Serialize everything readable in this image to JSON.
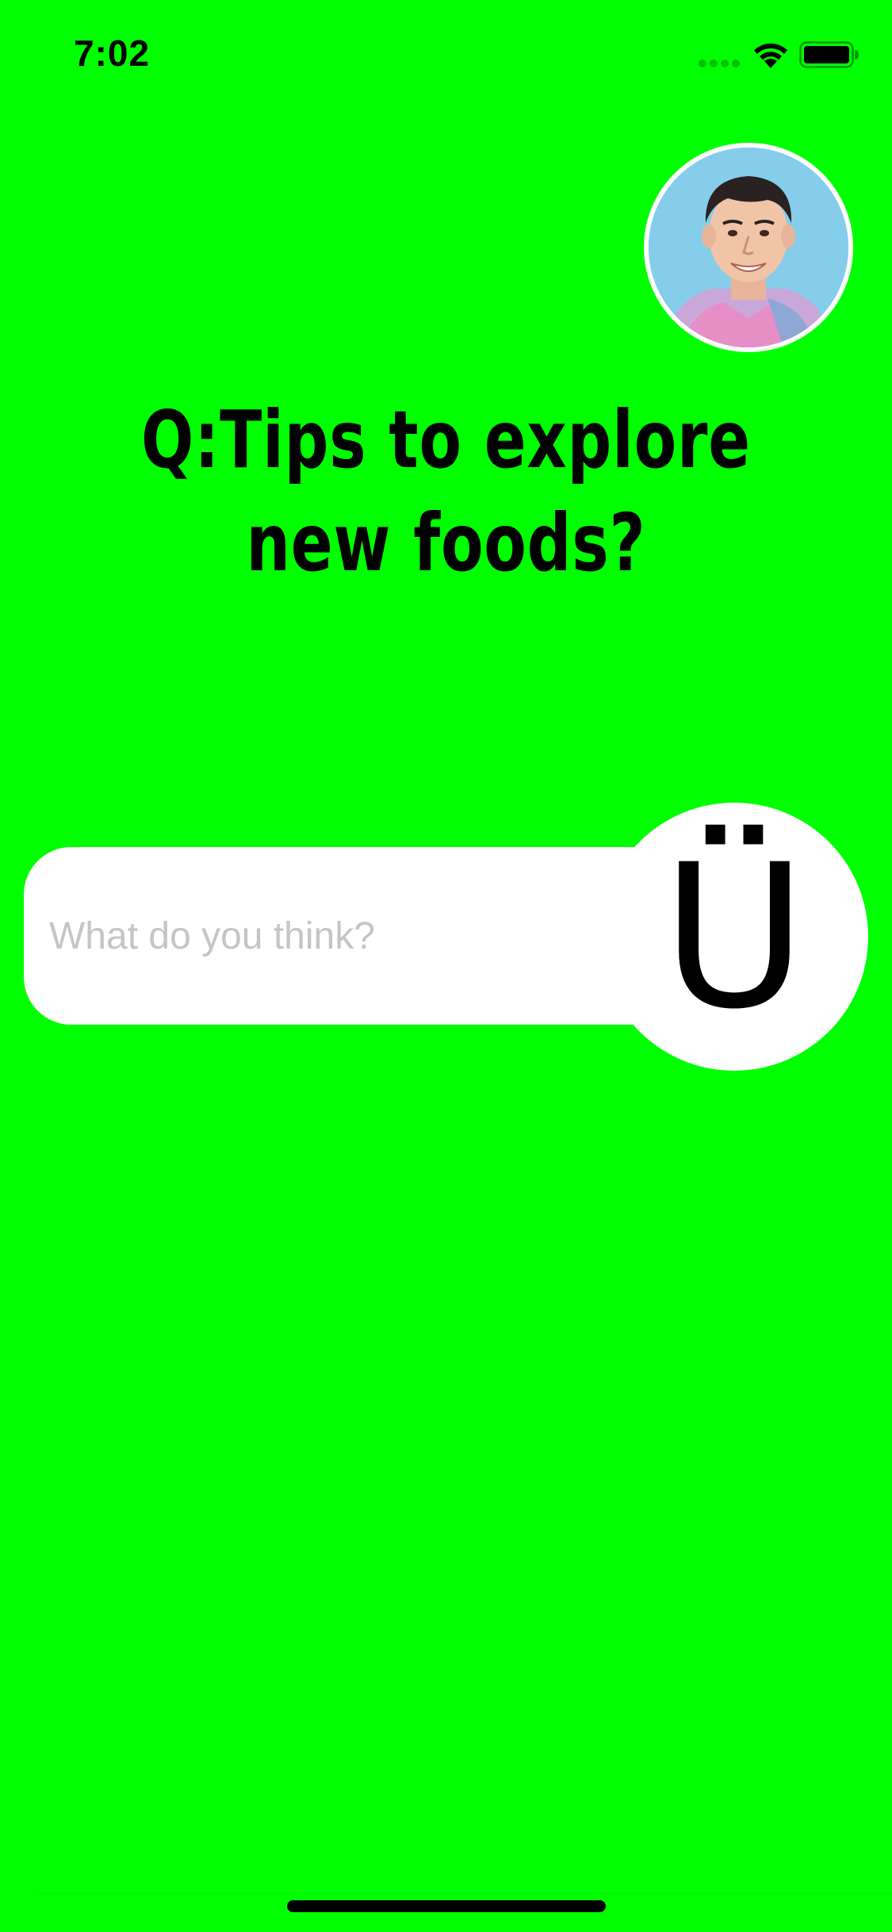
{
  "status_bar": {
    "time": "7:02",
    "icons": [
      "signal-dots-icon",
      "wifi-icon",
      "battery-icon"
    ]
  },
  "profile": {
    "avatar_icon": "user-avatar-photo"
  },
  "question": {
    "text": "Q:Tips to explore new foods?"
  },
  "answer": {
    "placeholder": "What do you think?",
    "value": "",
    "submit_glyph": "Ü"
  },
  "colors": {
    "background": "#00FF00",
    "input_background": "#FFFFFF",
    "placeholder": "#C5C5C5",
    "text": "#000000"
  }
}
